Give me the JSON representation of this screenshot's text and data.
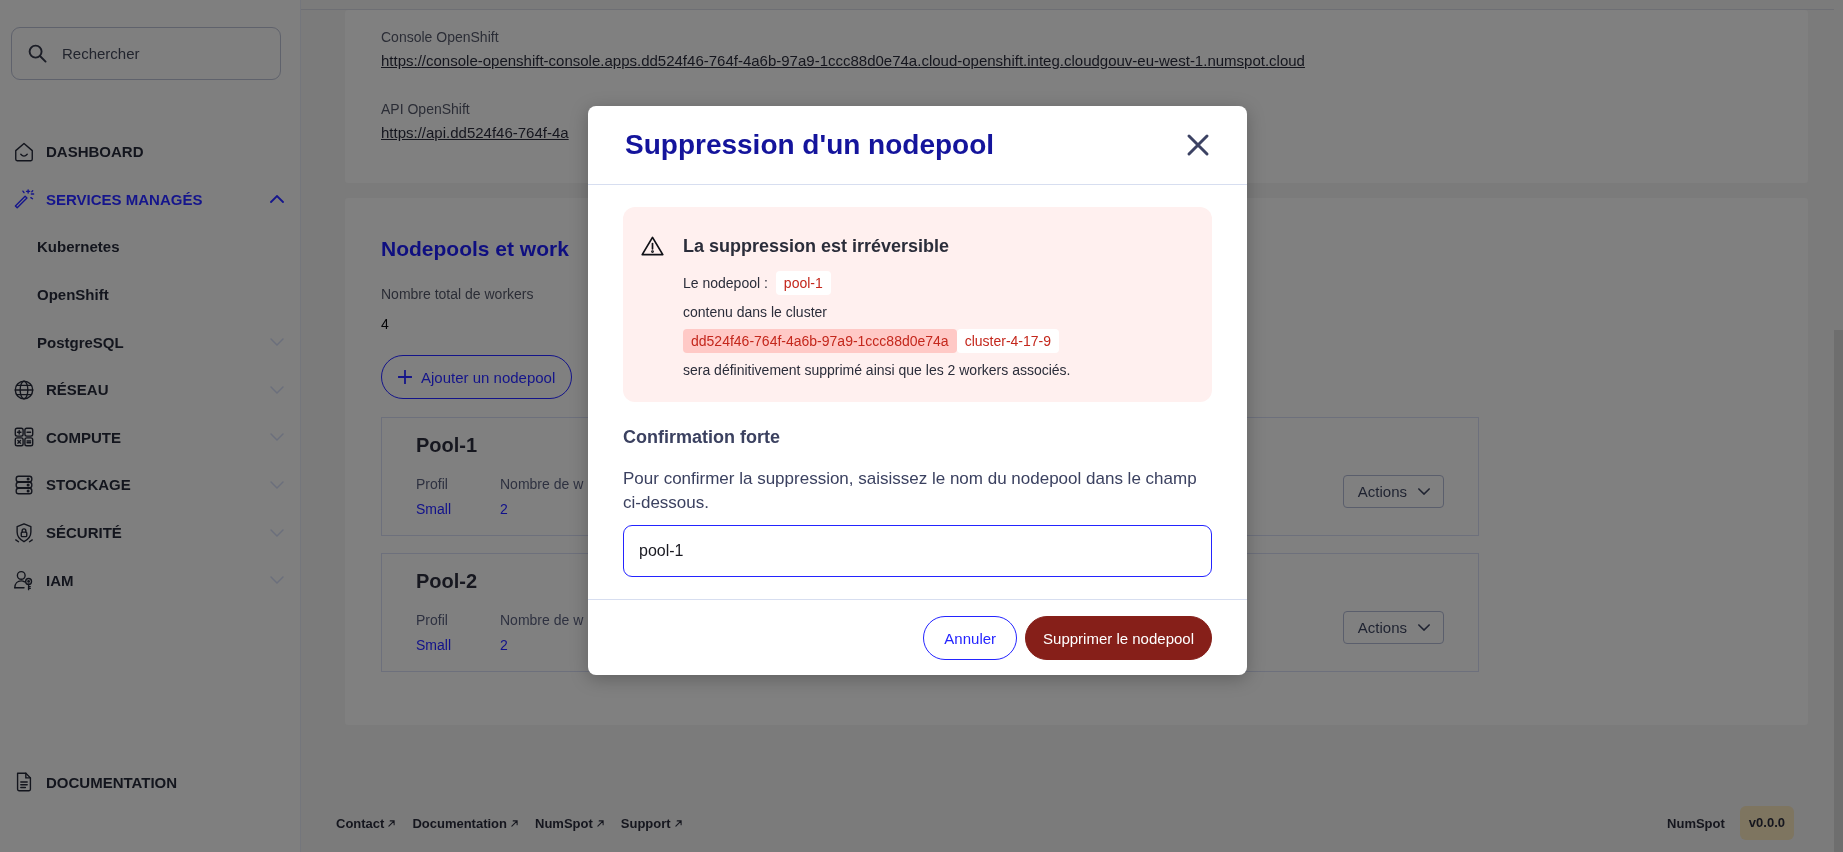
{
  "sidebar": {
    "search": {
      "placeholder": "Rechercher"
    },
    "items": [
      {
        "label": "DASHBOARD",
        "kind": "link",
        "selected": false
      },
      {
        "label": "SERVICES MANAGÉS",
        "kind": "group",
        "selected": true,
        "expanded": true,
        "children": [
          {
            "label": "Kubernetes",
            "kind": "link",
            "selected": false
          },
          {
            "label": "OpenShift",
            "kind": "link",
            "selected": false
          },
          {
            "label": "PostgreSQL",
            "kind": "group",
            "selected": false,
            "expanded": false
          }
        ]
      },
      {
        "label": "RÉSEAU",
        "kind": "group",
        "selected": false,
        "expanded": false
      },
      {
        "label": "COMPUTE",
        "kind": "group",
        "selected": false,
        "expanded": false
      },
      {
        "label": "STOCKAGE",
        "kind": "group",
        "selected": false,
        "expanded": false
      },
      {
        "label": "SÉCURITÉ",
        "kind": "group",
        "selected": false,
        "expanded": false
      },
      {
        "label": "IAM",
        "kind": "group",
        "selected": false,
        "expanded": false
      }
    ],
    "bottom_item": {
      "label": "DOCUMENTATION"
    }
  },
  "cluster_access": [
    {
      "label": "Console OpenShift",
      "url": "https://console-openshift-console.apps.dd524f46-764f-4a6b-97a9-1ccc88d0e74a.cloud-openshift.integ.cloudgouv-eu-west-1.numspot.cloud"
    },
    {
      "label": "API OpenShift",
      "url": "https://api.dd524f46-764f-4a"
    }
  ],
  "nodepools": {
    "title": "Nodepools et work",
    "total_label": "Nombre total de workers",
    "total": "4",
    "add_button": "Ajouter un nodepool",
    "pools": [
      {
        "name": "Pool-1",
        "fields": [
          {
            "label": "Profil",
            "value": "Small"
          },
          {
            "label": "Nombre de w",
            "value": "2"
          }
        ],
        "actions_button": "Actions"
      },
      {
        "name": "Pool-2",
        "fields": [
          {
            "label": "Profil",
            "value": "Small"
          },
          {
            "label": "Nombre de w",
            "value": "2"
          }
        ],
        "actions_button": "Actions"
      }
    ]
  },
  "footer": {
    "links": [
      "Contact",
      "Documentation",
      "NumSpot",
      "Support"
    ],
    "brand": "NumSpot",
    "version": "v0.0.0"
  },
  "modal": {
    "title": "Suppression d'un nodepool",
    "alert": {
      "title": "La suppression est irréversible",
      "lines": [
        [
          {
            "kind": "text",
            "text": "Le nodepool :"
          },
          {
            "kind": "tag",
            "text": "pool-1",
            "highlighted": false
          }
        ],
        [
          {
            "kind": "text",
            "text": "contenu dans le cluster"
          }
        ],
        [
          {
            "kind": "tag",
            "text": "dd524f46-764f-4a6b-97a9-1ccc88d0e74a",
            "highlighted": true
          },
          {
            "kind": "tag",
            "text": "cluster-4-17-9",
            "highlighted": false
          }
        ],
        [
          {
            "kind": "text",
            "text": "sera définitivement supprimé ainsi que les 2 workers associés."
          }
        ]
      ]
    },
    "confirmation": {
      "title": "Confirmation forte",
      "instructions": "Pour confirmer la suppression, saisissez le nom du nodepool dans le champ ci-dessous.",
      "input": {
        "value": "pool-1",
        "focused": true
      }
    },
    "buttons": [
      {
        "label": "Annuler",
        "kind": "secondary"
      },
      {
        "label": "Supprimer le nodepool",
        "kind": "danger"
      }
    ]
  }
}
